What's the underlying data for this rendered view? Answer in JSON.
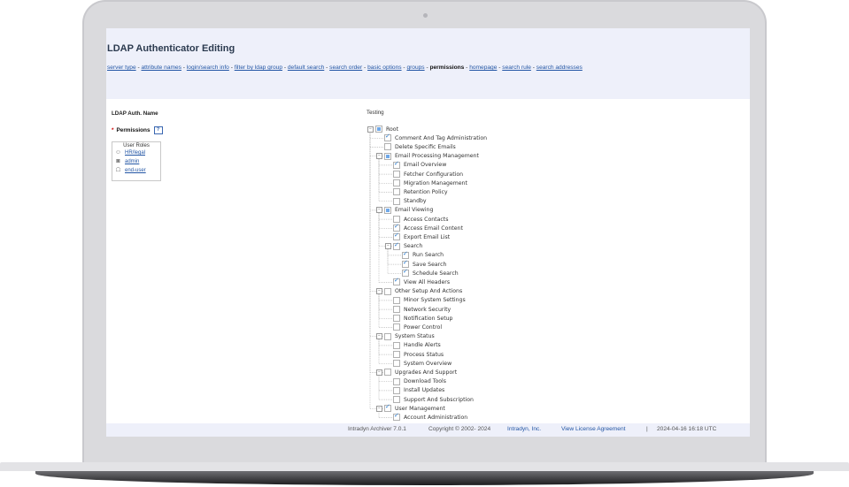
{
  "page": {
    "title": "LDAP Authenticator Editing",
    "tabs": [
      {
        "label": "server type",
        "current": false
      },
      {
        "label": "attribute names",
        "current": false
      },
      {
        "label": "login/search info",
        "current": false
      },
      {
        "label": "filter by ldap group",
        "current": false
      },
      {
        "label": "default search",
        "current": false
      },
      {
        "label": "search order",
        "current": false
      },
      {
        "label": "basic options",
        "current": false
      },
      {
        "label": "groups",
        "current": false
      },
      {
        "label": "permissions",
        "current": true
      },
      {
        "label": "homepage",
        "current": false
      },
      {
        "label": "search rule",
        "current": false
      },
      {
        "label": "search addresses",
        "current": false
      }
    ],
    "tab_separator": " - "
  },
  "form": {
    "auth_name_label": "LDAP Auth. Name",
    "auth_name_value": "Testing",
    "permissions_label": "Permissions",
    "required_marker": "*",
    "help_label": "?",
    "user_roles_header": "User Roles",
    "user_roles": [
      {
        "label": "HR/legal",
        "icon": "group-icon"
      },
      {
        "label": "admin",
        "icon": "admin-icon"
      },
      {
        "label": "end-user",
        "icon": "user-icon"
      }
    ]
  },
  "tree": [
    {
      "label": "Root",
      "level": 0,
      "state": "partial",
      "expandable": true
    },
    {
      "label": "Comment And Tag Administration",
      "level": 1,
      "state": "checked"
    },
    {
      "label": "Delete Specific Emails",
      "level": 1,
      "state": "unchecked"
    },
    {
      "label": "Email Processing Management",
      "level": 1,
      "state": "partial",
      "expandable": true
    },
    {
      "label": "Email Overview",
      "level": 2,
      "state": "checked"
    },
    {
      "label": "Fetcher Configuration",
      "level": 2,
      "state": "unchecked"
    },
    {
      "label": "Migration Management",
      "level": 2,
      "state": "unchecked"
    },
    {
      "label": "Retention Policy",
      "level": 2,
      "state": "unchecked"
    },
    {
      "label": "Standby",
      "level": 2,
      "state": "unchecked"
    },
    {
      "label": "Email Viewing",
      "level": 1,
      "state": "partial",
      "expandable": true
    },
    {
      "label": "Access Contacts",
      "level": 2,
      "state": "unchecked"
    },
    {
      "label": "Access Email Content",
      "level": 2,
      "state": "checked"
    },
    {
      "label": "Export Email List",
      "level": 2,
      "state": "checked"
    },
    {
      "label": "Search",
      "level": 2,
      "state": "checked",
      "expandable": true
    },
    {
      "label": "Run Search",
      "level": 3,
      "state": "checked"
    },
    {
      "label": "Save Search",
      "level": 3,
      "state": "checked"
    },
    {
      "label": "Schedule Search",
      "level": 3,
      "state": "checked"
    },
    {
      "label": "View All Headers",
      "level": 2,
      "state": "checked"
    },
    {
      "label": "Other Setup And Actions",
      "level": 1,
      "state": "unchecked",
      "expandable": true
    },
    {
      "label": "Minor System Settings",
      "level": 2,
      "state": "unchecked"
    },
    {
      "label": "Network Security",
      "level": 2,
      "state": "unchecked"
    },
    {
      "label": "Notification Setup",
      "level": 2,
      "state": "unchecked"
    },
    {
      "label": "Power Control",
      "level": 2,
      "state": "unchecked"
    },
    {
      "label": "System Status",
      "level": 1,
      "state": "unchecked",
      "expandable": true
    },
    {
      "label": "Handle Alerts",
      "level": 2,
      "state": "unchecked"
    },
    {
      "label": "Process Status",
      "level": 2,
      "state": "unchecked"
    },
    {
      "label": "System Overview",
      "level": 2,
      "state": "unchecked"
    },
    {
      "label": "Upgrades And Support",
      "level": 1,
      "state": "unchecked",
      "expandable": true
    },
    {
      "label": "Download Tools",
      "level": 2,
      "state": "unchecked"
    },
    {
      "label": "Install Updates",
      "level": 2,
      "state": "unchecked"
    },
    {
      "label": "Support And Subscription",
      "level": 2,
      "state": "unchecked"
    },
    {
      "label": "User Management",
      "level": 1,
      "state": "checked",
      "expandable": true
    },
    {
      "label": "Account Administration",
      "level": 2,
      "state": "checked"
    }
  ],
  "footer": {
    "product": "Intradyn Archiver 7.0.1",
    "copyright": "Copyright © 2002- 2024",
    "company": "Intradyn, Inc.",
    "license": "View License Agreement",
    "divider": "|",
    "timestamp": "2024-04-16 16:18 UTC"
  },
  "colors": {
    "header_bg": "#eef0fa",
    "link": "#2356a5",
    "check": "#2d7fd3",
    "required": "#cc0000"
  }
}
